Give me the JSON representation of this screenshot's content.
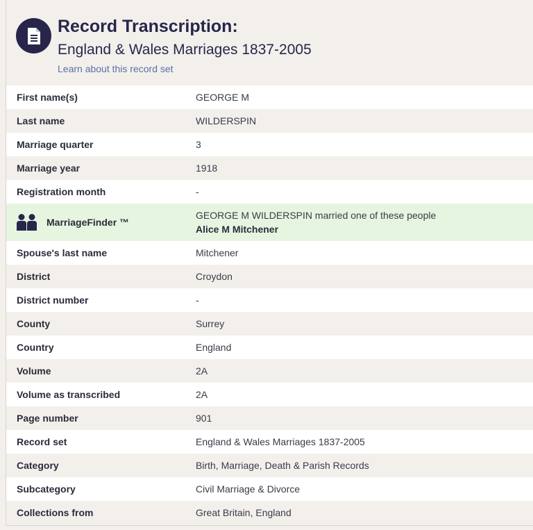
{
  "header": {
    "icon": "document-icon",
    "title": "Record Transcription:",
    "subtitle": "England & Wales Marriages 1837-2005",
    "learn_link": "Learn about this record set"
  },
  "rows_before": [
    {
      "label": "First name(s)",
      "value": "GEORGE M"
    },
    {
      "label": "Last name",
      "value": "WILDERSPIN"
    },
    {
      "label": "Marriage quarter",
      "value": "3"
    },
    {
      "label": "Marriage year",
      "value": "1918"
    },
    {
      "label": "Registration month",
      "value": "-"
    }
  ],
  "marriage_finder": {
    "icon": "people-icon",
    "label": "MarriageFinder ™",
    "description": "GEORGE M WILDERSPIN married one of these people",
    "spouse": "Alice M Mitchener"
  },
  "rows_after": [
    {
      "label": "Spouse's last name",
      "value": "Mitchener"
    },
    {
      "label": "District",
      "value": "Croydon"
    },
    {
      "label": "District number",
      "value": "-"
    },
    {
      "label": "County",
      "value": "Surrey"
    },
    {
      "label": "Country",
      "value": "England"
    },
    {
      "label": "Volume",
      "value": "2A"
    },
    {
      "label": "Volume as transcribed",
      "value": "2A"
    },
    {
      "label": "Page number",
      "value": "901"
    },
    {
      "label": "Record set",
      "value": "England & Wales Marriages 1837-2005"
    },
    {
      "label": "Category",
      "value": "Birth, Marriage, Death & Parish Records"
    },
    {
      "label": "Subcategory",
      "value": "Civil Marriage & Divorce"
    },
    {
      "label": "Collections from",
      "value": "Great Britain, England"
    }
  ],
  "colors": {
    "navy": "#27264a",
    "finder_bg": "#e6f5e0",
    "link": "#5b6fa6",
    "stripe": "#f3f0ec"
  }
}
